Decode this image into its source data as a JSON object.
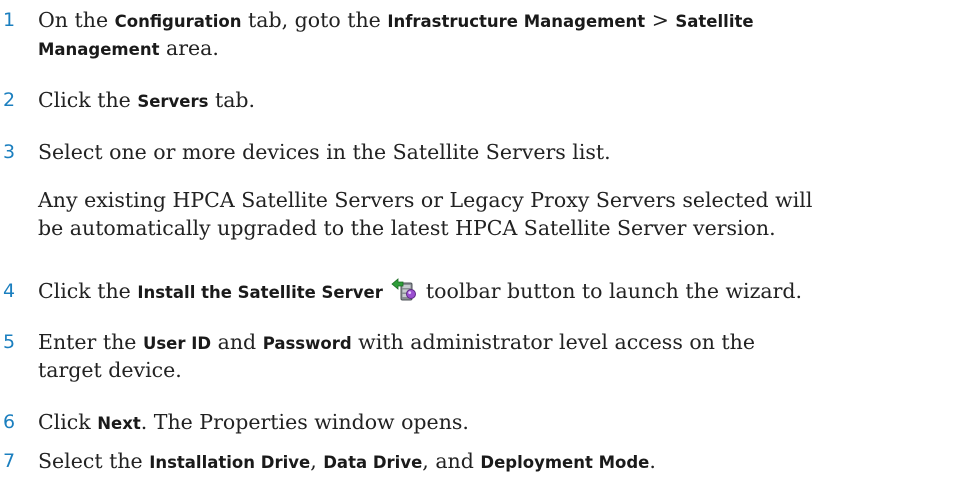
{
  "steps": [
    {
      "num": "1",
      "line1": {
        "t1": "On the ",
        "b1": "Configuration",
        "t2": " tab, goto the ",
        "b2": "Infrastructure Management",
        "t3": " > ",
        "b3": "Satellite"
      },
      "line2": {
        "b1": "Management",
        "t1": " area."
      }
    },
    {
      "num": "2",
      "t1": "Click the ",
      "b1": "Servers",
      "t2": " tab."
    },
    {
      "num": "3",
      "t1": "Select one or more devices in the Satellite Servers list.",
      "note_line1": "Any existing HPCA Satellite Servers or Legacy Proxy Servers selected will",
      "note_line2": "be automatically upgraded to the latest HPCA Satellite Server version."
    },
    {
      "num": "4",
      "t1": "Click the ",
      "b1": "Install the Satellite Server",
      "icon": "install-satellite-server-icon",
      "t2": " toolbar button to launch the wizard."
    },
    {
      "num": "5",
      "line1": {
        "t1": "Enter the ",
        "b1": "User ID",
        "t2": " and ",
        "b2": "Password",
        "t3": " with administrator level access on the"
      },
      "line2": {
        "t1": "target device."
      }
    },
    {
      "num": "6",
      "t1": "Click ",
      "b1": "Next",
      "t2": ". The Properties window opens."
    },
    {
      "num": "7",
      "t1": "Select the ",
      "b1": "Installation Drive",
      "t2": ", ",
      "b2": "Data Drive",
      "t3": ", and ",
      "b3": "Deployment Mode",
      "t4": "."
    }
  ]
}
